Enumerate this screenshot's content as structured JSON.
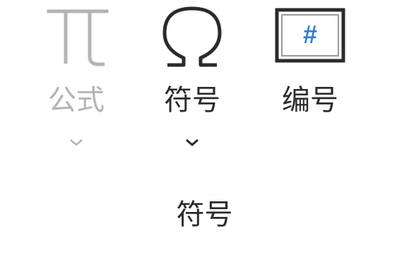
{
  "ribbon_group": {
    "label": "符号",
    "commands": {
      "formula": {
        "label": "公式",
        "icon": "pi-icon",
        "enabled": false,
        "has_dropdown": true
      },
      "symbol": {
        "label": "符号",
        "icon": "omega-icon",
        "enabled": true,
        "has_dropdown": true
      },
      "number": {
        "label": "编号",
        "icon": "number-icon",
        "icon_glyph": "#",
        "enabled": true,
        "has_dropdown": false
      }
    }
  },
  "colors": {
    "text": "#2b2b2b",
    "disabled_text": "#b4b4b4",
    "accent_blue": "#2f7fd1"
  }
}
